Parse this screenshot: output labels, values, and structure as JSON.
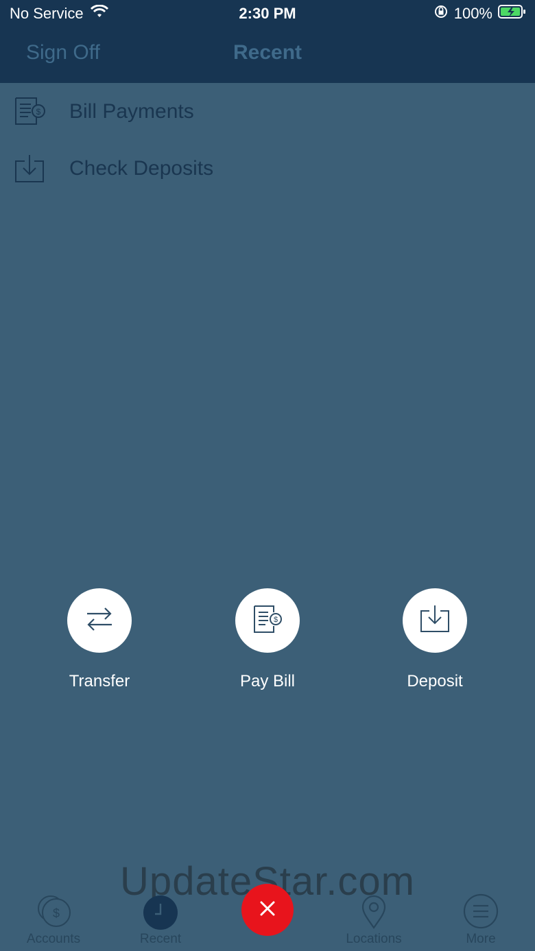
{
  "status_bar": {
    "carrier": "No Service",
    "time": "2:30 PM",
    "battery": "100%"
  },
  "nav": {
    "sign_off": "Sign Off",
    "title": "Recent"
  },
  "recent_items": [
    {
      "label": "Bill Payments",
      "icon": "bill-icon"
    },
    {
      "label": "Check Deposits",
      "icon": "deposit-icon"
    }
  ],
  "actions": [
    {
      "label": "Transfer",
      "icon": "transfer-icon"
    },
    {
      "label": "Pay Bill",
      "icon": "bill-icon"
    },
    {
      "label": "Deposit",
      "icon": "deposit-icon"
    }
  ],
  "watermark": "UpdateStar.com",
  "tabs": [
    {
      "label": "Accounts",
      "icon": "dollar-coins-icon"
    },
    {
      "label": "Recent",
      "icon": "clock-icon"
    },
    {
      "label": "Locations",
      "icon": "location-pin-icon"
    },
    {
      "label": "More",
      "icon": "menu-icon"
    }
  ],
  "fab": {
    "icon": "close-icon"
  },
  "colors": {
    "nav_bg": "#173552",
    "overlay_bg": "#3c5f77",
    "fab_red": "#e8141c"
  }
}
